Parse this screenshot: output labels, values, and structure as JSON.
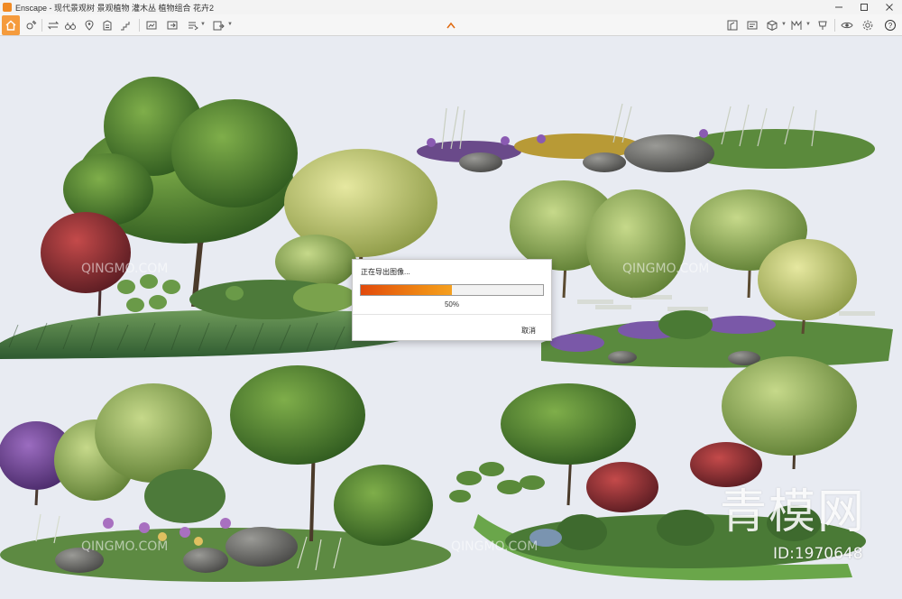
{
  "window": {
    "app_name": "Enscape",
    "title": "Enscape - 现代景观树 景观植物 灌木丛 植物组合 花卉2",
    "controls": [
      "minimize",
      "maximize",
      "close"
    ]
  },
  "toolbar": {
    "left_icons": [
      "home-icon",
      "sun-icon",
      "binoculars-icon",
      "map-icon",
      "warning-icon",
      "building-icon",
      "video-path-icon",
      "screenshot-icon",
      "export-icon",
      "batch-export-icon",
      "upload-icon"
    ],
    "right_icons": [
      "asset-library-icon",
      "material-icon",
      "box-icon",
      "view-icon",
      "visual-settings-icon",
      "eye-icon",
      "settings-icon",
      "help-icon"
    ],
    "collapse_glyph": "^"
  },
  "dialog": {
    "title": "正在导出图像...",
    "progress": 0.5,
    "progress_text": "50%",
    "cancel_label": "取消",
    "fill_color": "#ee7a12"
  },
  "watermark": {
    "logo_text": "青模网",
    "id_text": "ID:1970648",
    "site_text": "QINGMO.COM"
  }
}
